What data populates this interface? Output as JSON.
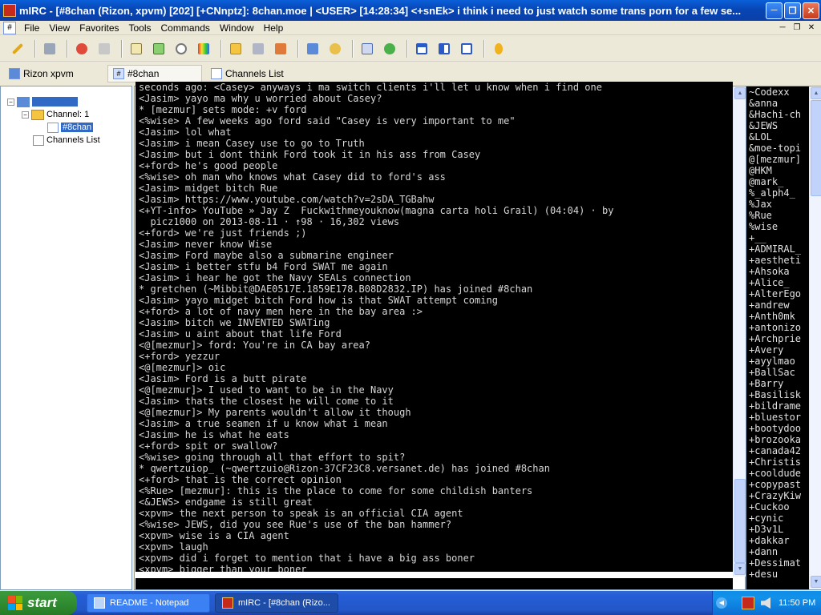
{
  "window": {
    "title": "mIRC - [#8chan (Rizon, xpvm) [202] [+CNnptz]: 8chan.moe  |  <USER> [14:28:34] <+snEk> i think i need to just watch some trans porn for a few se...",
    "app_icon": "mIRC"
  },
  "menu": {
    "items": [
      "File",
      "View",
      "Favorites",
      "Tools",
      "Commands",
      "Window",
      "Help"
    ]
  },
  "toolbar": {
    "icons": [
      "connect-icon",
      "options-icon",
      "favorites-icon",
      "address-book-icon",
      "script-editor-icon",
      "log-icon",
      "timer-icon",
      "colors-icon",
      "channels-folder-icon",
      "dcc-send-icon",
      "dcc-chat-icon",
      "received-files-icon",
      "notify-icon",
      "url-list-icon",
      "tile-horizontal-icon",
      "tile-vertical-icon",
      "cascade-icon",
      "help-icon"
    ]
  },
  "switchbar": {
    "tabs": [
      {
        "label": "Rizon xpvm",
        "active": false
      },
      {
        "label": "#8chan",
        "active": true
      },
      {
        "label": "Channels List",
        "active": false
      }
    ]
  },
  "tree": {
    "network": "Rizon xpvm",
    "channel_group": "Channel: 1",
    "channel": "#8chan",
    "channels_list": "Channels List"
  },
  "chat": {
    "lines": [
      {
        "t": "seconds ago: <Casey> anyways i ma switch clients i'll let u know when i find one",
        "c": "#d6d6d6"
      },
      {
        "t": "<Jasim> yayo ma why u worried about Casey?",
        "c": "#d6d6d6"
      },
      {
        "t": "* [mezmur] sets mode: +v ford",
        "c": "#d6d6d6"
      },
      {
        "t": "<%wise> A few weeks ago ford said \"Casey is very important to me\"",
        "c": "#d6d6d6"
      },
      {
        "t": "<Jasim> lol what",
        "c": "#d6d6d6"
      },
      {
        "t": "<Jasim> i mean Casey use to go to Truth",
        "c": "#d6d6d6"
      },
      {
        "t": "<Jasim> but i dont think Ford took it in his ass from Casey",
        "c": "#d6d6d6"
      },
      {
        "t": "<+ford> he's good people",
        "c": "#d6d6d6"
      },
      {
        "t": "<%wise> oh man who knows what Casey did to ford's ass",
        "c": "#d6d6d6"
      },
      {
        "t": "<Jasim> midget bitch Rue",
        "c": "#d6d6d6"
      },
      {
        "t": "<Jasim> https://www.youtube.com/watch?v=2sDA_TGBahw",
        "c": "#d6d6d6"
      },
      {
        "t": "<+YT-info> YouTube » Jay Z  Fuckwithmeyouknow(magna carta holi Grail) (04:04) · by",
        "c": "#d6d6d6"
      },
      {
        "t": "  picz1000 on 2013-08-11 · ↑98 · 16,302 views",
        "c": "#d6d6d6"
      },
      {
        "t": "<+ford> we're just friends ;)",
        "c": "#d6d6d6"
      },
      {
        "t": "<Jasim> never know Wise",
        "c": "#d6d6d6"
      },
      {
        "t": "<Jasim> Ford maybe also a submarine engineer",
        "c": "#d6d6d6"
      },
      {
        "t": "<Jasim> i better stfu b4 Ford SWAT me again",
        "c": "#d6d6d6"
      },
      {
        "t": "<Jasim> i hear he got the Navy SEALs connection",
        "c": "#d6d6d6"
      },
      {
        "t": "* gretchen (~Mibbit@DAE0517E.1859E178.B08D2832.IP) has joined #8chan",
        "c": "#d6d6d6"
      },
      {
        "t": "<Jasim> yayo midget bitch Ford how is that SWAT attempt coming",
        "c": "#d6d6d6"
      },
      {
        "t": "<+ford> a lot of navy men here in the bay area :>",
        "c": "#d6d6d6"
      },
      {
        "t": "<Jasim> bitch we INVENTED SWATing",
        "c": "#d6d6d6"
      },
      {
        "t": "<Jasim> u aint about that life Ford",
        "c": "#d6d6d6"
      },
      {
        "t": "<@[mezmur]> ford: You're in CA bay area?",
        "c": "#d6d6d6"
      },
      {
        "t": "<+ford> yezzur",
        "c": "#d6d6d6"
      },
      {
        "t": "<@[mezmur]> oic",
        "c": "#d6d6d6"
      },
      {
        "t": "<Jasim> Ford is a butt pirate",
        "c": "#d6d6d6"
      },
      {
        "t": "<@[mezmur]> I used to want to be in the Navy",
        "c": "#d6d6d6"
      },
      {
        "t": "<Jasim> thats the closest he will come to it",
        "c": "#d6d6d6"
      },
      {
        "t": "<@[mezmur]> My parents wouldn't allow it though",
        "c": "#d6d6d6"
      },
      {
        "t": "<Jasim> a true seamen if u know what i mean",
        "c": "#d6d6d6"
      },
      {
        "t": "<Jasim> he is what he eats",
        "c": "#d6d6d6"
      },
      {
        "t": "<+ford> spit or swallow?",
        "c": "#d6d6d6"
      },
      {
        "t": "<%wise> going through all that effort to spit?",
        "c": "#d6d6d6"
      },
      {
        "t": "* qwertzuiop_ (~qwertzuio@Rizon-37CF23C8.versanet.de) has joined #8chan",
        "c": "#d6d6d6"
      },
      {
        "t": "<+ford> that is the correct opinion",
        "c": "#d6d6d6"
      },
      {
        "t": "<%Rue> [mezmur]: this is the place to come for some childish banters",
        "c": "#d6d6d6"
      },
      {
        "t": "<&JEWS> endgame is still great",
        "c": "#d6d6d6"
      },
      {
        "t": "<xpvm> the next person to speak is an official CIA agent",
        "c": "#d6d6d6"
      },
      {
        "t": "<%wise> JEWS, did you see Rue's use of the ban hammer?",
        "c": "#d6d6d6"
      },
      {
        "t": "<xpvm> wise is a CIA agent",
        "c": "#d6d6d6"
      },
      {
        "t": "<xpvm> laugh",
        "c": "#d6d6d6"
      },
      {
        "t": "<xpvm> did i forget to mention that i have a big ass boner",
        "c": "#d6d6d6"
      },
      {
        "t": "<xpvm> bigger than your boner",
        "c": "#d6d6d6"
      }
    ]
  },
  "nicklist": [
    "~Codexx",
    "&anna",
    "&Hachi-ch",
    "&JEWS",
    "&LOL",
    "&moe-topi",
    "@[mezmur]",
    "@HKM",
    "@mark_",
    "%_alph4_",
    "%Jax",
    "%Rue",
    "%wise",
    "+__",
    "+ADMIRAL_",
    "+aestheti",
    "+Ahsoka",
    "+Alice_",
    "+AlterEgo",
    "+andrew",
    "+Anth0mk",
    "+antonizo",
    "+Archprie",
    "+Avery",
    "+ayylmao",
    "+BallSac",
    "+Barry",
    "+Basilisk",
    "+bildrame",
    "+bluestor",
    "+bootydoo",
    "+brozooka",
    "+canada42",
    "+Christis",
    "+cooldude",
    "+copypast",
    "+CrazyKiw",
    "+Cuckoo",
    "+cynic",
    "+D3v1L",
    "+dakkar",
    "+dann",
    "+Dessimat",
    "+desu"
  ],
  "taskbar": {
    "start_label": "start",
    "tasks": [
      {
        "label": "README - Notepad",
        "active": false
      },
      {
        "label": "mIRC - [#8chan (Rizo...",
        "active": true
      }
    ],
    "clock": "11:50 PM"
  },
  "colors": {
    "chat_bg": "#000000",
    "chat_fg": "#d6d6d6",
    "xp_blue": "#0a3fa8",
    "selection": "#316ac5"
  }
}
